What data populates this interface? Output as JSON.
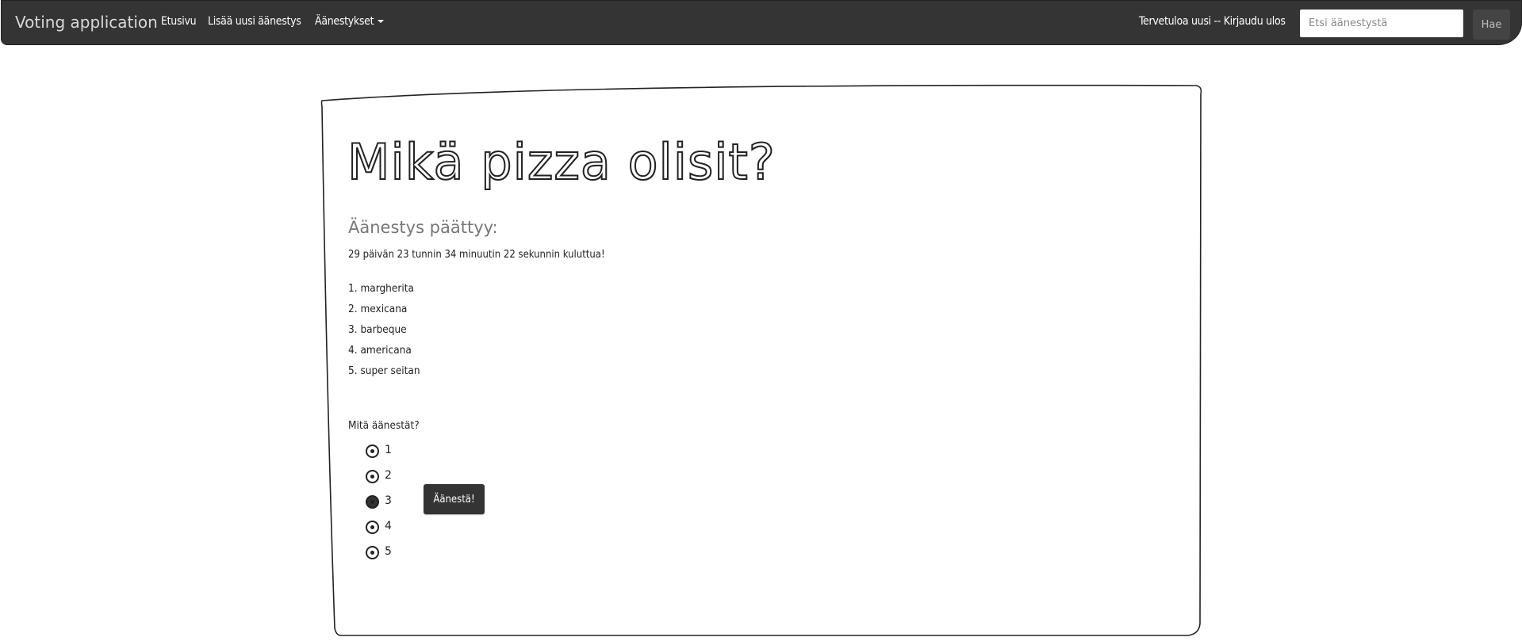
{
  "navbar": {
    "brand": "Voting application",
    "links": [
      {
        "label": "Etusivu"
      },
      {
        "label": "Lisää uusi äänestys"
      },
      {
        "label": "Äänestykset"
      }
    ],
    "greeting": "Tervetuloa uusi -- Kirjaudu ulos",
    "search": {
      "placeholder": "Etsi äänestystä",
      "value": ""
    },
    "search_button": "Hae"
  },
  "poll": {
    "title": "Mikä pizza olisit?",
    "deadline_heading": "Äänestys päättyy:",
    "countdown": "29 päivän 23 tunnin 34 minuutin 22 sekunnin kuluttua!",
    "options": [
      "1. margherita",
      "2. mexicana",
      "3. barbeque",
      "4. americana",
      "5. super seitan"
    ],
    "vote_prompt": "Mitä äänestät?",
    "choices": [
      "1",
      "2",
      "3",
      "4",
      "5"
    ],
    "selected_choice": "3",
    "vote_button": "Äänestä!"
  }
}
